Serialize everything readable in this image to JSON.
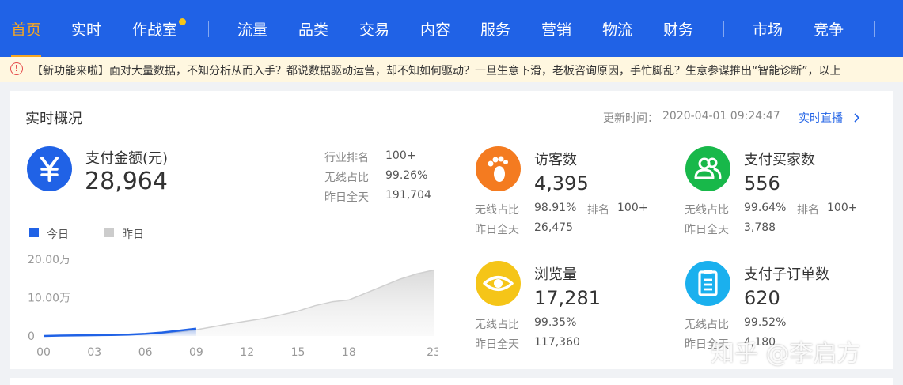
{
  "nav": {
    "items": [
      "首页",
      "实时",
      "作战室",
      "流量",
      "品类",
      "交易",
      "内容",
      "服务",
      "营销",
      "物流",
      "财务",
      "市场",
      "竞争"
    ],
    "active": "首页"
  },
  "notice": {
    "text": "【新功能来啦】面对大量数据，不知分析从而入手？都说数据驱动运营，却不知如何驱动？一旦生意下滑，老板咨询原因，手忙脚乱？生意参谋推出“智能诊断”，以上"
  },
  "realtime": {
    "title": "实时概况",
    "update_label": "更新时间：",
    "update_time": "2020-04-01 09:24:47",
    "live_link": "实时直播",
    "pay_amount": {
      "icon": "yen-icon",
      "label": "支付金额(元)",
      "value": "28,964",
      "stats": [
        {
          "label": "行业排名",
          "value": "100+"
        },
        {
          "label": "无线占比",
          "value": "99.26%"
        },
        {
          "label": "昨日全天",
          "value": "191,704"
        }
      ]
    },
    "visitors": {
      "icon": "footprint-icon",
      "label": "访客数",
      "value": "4,395",
      "wireless_label": "无线占比",
      "wireless": "98.91%",
      "rank_label": "排名",
      "rank": "100+",
      "yesterday_label": "昨日全天",
      "yesterday": "26,475"
    },
    "buyers": {
      "icon": "users-icon",
      "label": "支付买家数",
      "value": "556",
      "wireless_label": "无线占比",
      "wireless": "99.64%",
      "rank_label": "排名",
      "rank": "100+",
      "yesterday_label": "昨日全天",
      "yesterday": "3,788"
    },
    "pageviews": {
      "icon": "eye-icon",
      "label": "浏览量",
      "value": "17,281",
      "wireless_label": "无线占比",
      "wireless": "99.35%",
      "yesterday_label": "昨日全天",
      "yesterday": "117,360"
    },
    "suborders": {
      "icon": "order-list-icon",
      "label": "支付子订单数",
      "value": "620",
      "wireless_label": "无线占比",
      "wireless": "99.52%",
      "yesterday_label": "昨日全天",
      "yesterday": "4,180"
    }
  },
  "colors": {
    "nav_bg": "#2062e6",
    "nav_active": "#f5a623",
    "today": "#2062e6",
    "yesterday": "#cccccc",
    "visitors_icon": "#f47b20",
    "buyers_icon": "#18b84a",
    "pageviews_icon": "#f5c518",
    "suborders_icon": "#1ab0ee"
  },
  "chart_data": {
    "type": "area",
    "legend": [
      "今日",
      "昨日"
    ],
    "ytick_labels": [
      "20.00万",
      "10.00万",
      "0"
    ],
    "ylim": [
      0,
      200000
    ],
    "x_ticks": [
      "00",
      "03",
      "06",
      "09",
      "12",
      "15",
      "18",
      "23"
    ],
    "series": [
      {
        "name": "今日",
        "x": [
          0,
          1,
          2,
          3,
          4,
          5,
          6,
          7,
          8,
          9
        ],
        "values": [
          0,
          1000,
          1500,
          2000,
          2500,
          3500,
          5500,
          9000,
          14000,
          19000
        ]
      },
      {
        "name": "昨日",
        "x": [
          0,
          1,
          2,
          3,
          4,
          5,
          6,
          7,
          8,
          9,
          10,
          11,
          12,
          13,
          14,
          15,
          16,
          17,
          18,
          19,
          20,
          21,
          22,
          23
        ],
        "values": [
          0,
          500,
          1000,
          1500,
          2000,
          3000,
          4500,
          7000,
          11000,
          16000,
          24000,
          32000,
          39000,
          46000,
          55000,
          65000,
          79000,
          89000,
          94000,
          112000,
          130000,
          148000,
          162000,
          172000
        ]
      }
    ]
  },
  "watermark": "知乎 @李启方"
}
